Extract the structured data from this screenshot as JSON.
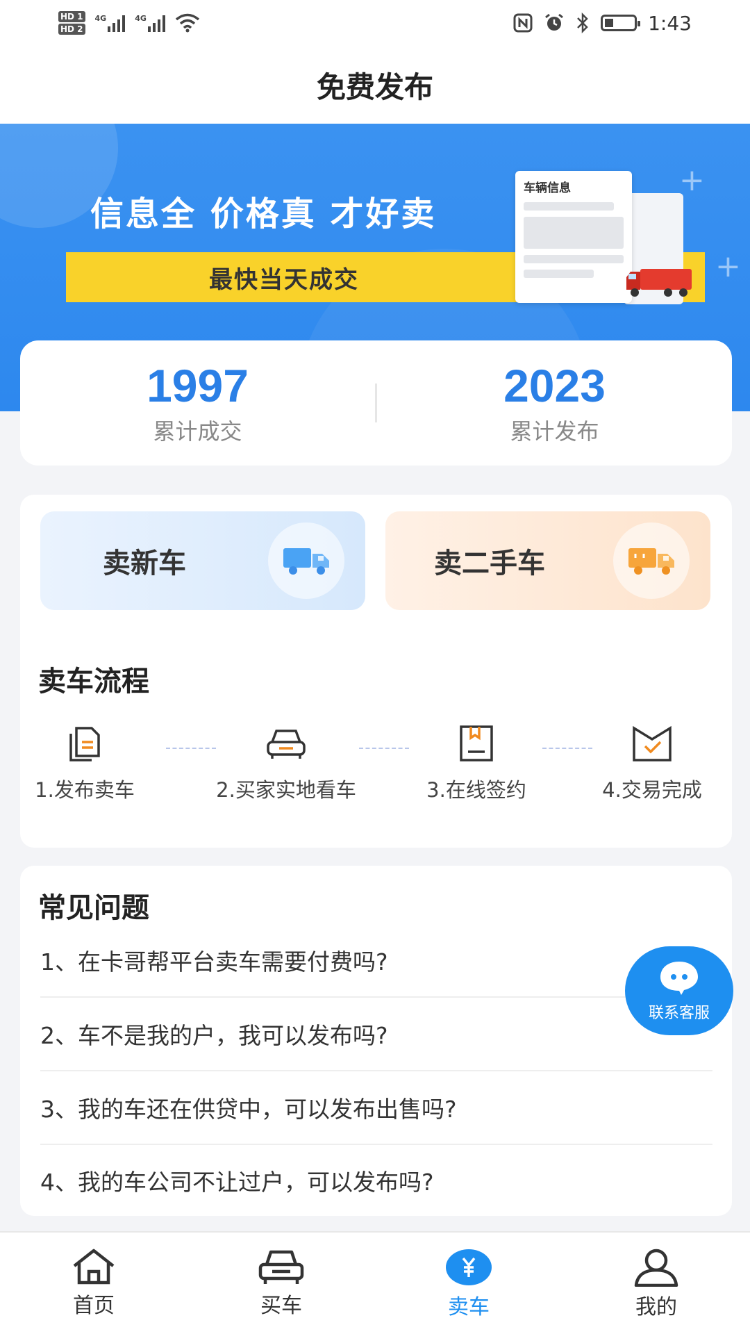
{
  "status_bar": {
    "hd1": "HD 1",
    "hd2": "HD 2",
    "net1": "4G",
    "net2": "4G",
    "time": "1:43"
  },
  "header": {
    "title": "免费发布"
  },
  "banner": {
    "headline": "信息全 价格真 才好卖",
    "subline": "最快当天成交",
    "card_title": "车辆信息"
  },
  "stats": [
    {
      "value": "1997",
      "label": "累计成交"
    },
    {
      "value": "2023",
      "label": "累计发布"
    }
  ],
  "sell_options": {
    "new_label": "卖新车",
    "used_label": "卖二手车"
  },
  "process": {
    "title": "卖车流程",
    "steps": [
      {
        "label": "1.发布卖车",
        "icon": "document-icon"
      },
      {
        "label": "2.买家实地看车",
        "icon": "car-icon"
      },
      {
        "label": "3.在线签约",
        "icon": "contract-icon"
      },
      {
        "label": "4.交易完成",
        "icon": "check-envelope-icon"
      }
    ]
  },
  "faq": {
    "title": "常见问题",
    "items": [
      "1、在卡哥帮平台卖车需要付费吗?",
      "2、车不是我的户，我可以发布吗?",
      "3、我的车还在供贷中，可以发布出售吗?",
      "4、我的车公司不让过户，可以发布吗?"
    ]
  },
  "customer_service": {
    "label": "联系客服"
  },
  "tabbar": {
    "items": [
      {
        "label": "首页",
        "icon": "home-icon",
        "active": false
      },
      {
        "label": "买车",
        "icon": "car-icon",
        "active": false
      },
      {
        "label": "卖车",
        "icon": "yen-icon",
        "active": true
      },
      {
        "label": "我的",
        "icon": "user-icon",
        "active": false
      }
    ]
  },
  "colors": {
    "accent": "#1e8ff0",
    "banner_blue": "#2d88ee",
    "banner_yellow": "#f9d22a",
    "stat_number": "#2a7fe6"
  }
}
